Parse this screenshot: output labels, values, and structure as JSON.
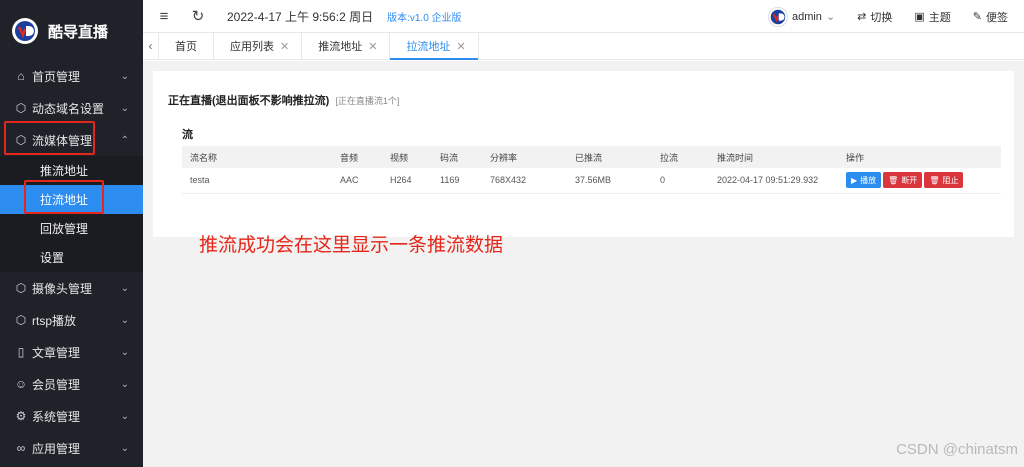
{
  "brand": {
    "title": "酷导直播"
  },
  "sidebar": {
    "items": [
      {
        "label": "首页管理",
        "icon": "home-icon"
      },
      {
        "label": "动态域名设置",
        "icon": "cube-icon"
      },
      {
        "label": "流媒体管理",
        "icon": "cube-icon"
      },
      {
        "label": "摄像头管理",
        "icon": "cube-icon"
      },
      {
        "label": "rtsp播放",
        "icon": "cube-icon"
      },
      {
        "label": "文章管理",
        "icon": "document-icon"
      },
      {
        "label": "会员管理",
        "icon": "users-icon"
      },
      {
        "label": "系统管理",
        "icon": "gear-icon"
      },
      {
        "label": "应用管理",
        "icon": "link-icon"
      }
    ],
    "subitems": [
      "推流地址",
      "拉流地址",
      "回放管理",
      "设置"
    ]
  },
  "topbar": {
    "datetime": "2022-4-17 上午 9:56:2 周日",
    "version": "版本:v1.0 企业版",
    "user": "admin",
    "switch_label": "切换",
    "theme_label": "主题",
    "notes_label": "便签"
  },
  "tabs": [
    "首页",
    "应用列表",
    "推流地址",
    "拉流地址"
  ],
  "panel": {
    "title": "正在直播(退出面板不影响推拉流)",
    "hint": "[正在直播流1个]",
    "section": "流"
  },
  "table": {
    "headers": [
      "流名称",
      "音频",
      "视频",
      "码流",
      "分辨率",
      "已推流",
      "拉流",
      "推流时间",
      "操作"
    ],
    "rows": [
      {
        "name": "testa",
        "audio": "AAC",
        "video": "H264",
        "bitrate": "1169",
        "resolution": "768X432",
        "pushed": "37.56MB",
        "pull": "0",
        "time": "2022-04-17 09:51:29.932"
      }
    ],
    "actions": {
      "play": "播放",
      "disconnect": "断开",
      "block": "阻止"
    }
  },
  "annotation": "推流成功会在这里显示一条推流数据",
  "watermark": "CSDN @chinatsm",
  "colors": {
    "accent": "#2d8cf0",
    "danger": "#d9363e",
    "annotation": "#e4271a",
    "sidebar_bg": "#20222a"
  }
}
